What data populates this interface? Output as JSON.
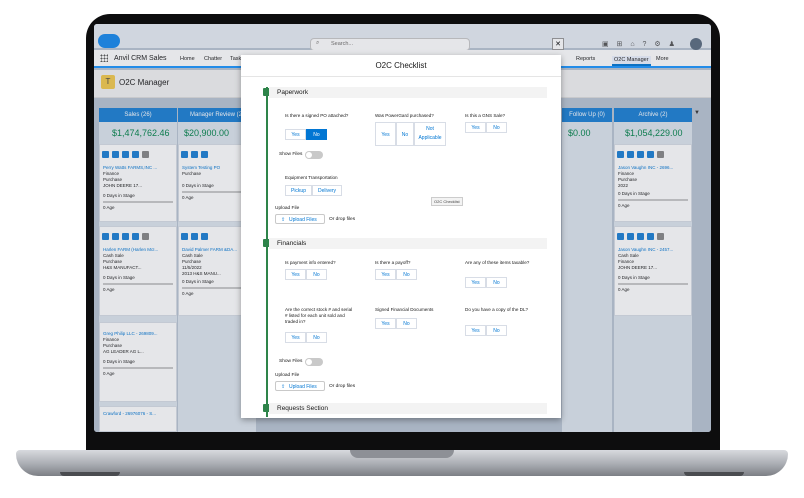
{
  "app": {
    "name": "Anvil CRM Sales",
    "search_placeholder": "Search...",
    "tabs": [
      "Home",
      "Chatter",
      "Task"
    ],
    "right_tabs": [
      "Reports",
      "O2C Manager",
      "More"
    ],
    "page_title": "O2C Manager"
  },
  "board": {
    "sales": {
      "label": "Sales (26)",
      "amount": "$1,474,762.46",
      "cards": [
        {
          "name": "Perry Watts FARMS,INC ...",
          "type": "Finance",
          "sub": "Purchase",
          "product": "JOHN DEERE 17...",
          "stage": "0 Days in Stage",
          "age": "0 Age"
        },
        {
          "name": "Harlen FARM (Harlen McI...",
          "type": "Cash Sale",
          "sub": "Purchase",
          "product": "H&S MANUFACT...",
          "stage": "0 Days in Stage",
          "age": "0 Age"
        },
        {
          "name": "Greg Philip LLC - 269809...",
          "type": "Finance",
          "sub": "Purchase",
          "product": "AG LEADER AG L...",
          "stage": "0 Days in Stage",
          "age": "0 Age"
        },
        {
          "name": "Crawford - 26976076 - S...",
          "type": "",
          "sub": "",
          "product": "",
          "stage": "",
          "age": ""
        }
      ]
    },
    "manager": {
      "label": "Manager Review (2)",
      "amount": "$20,900.00",
      "cards": [
        {
          "name": "System Testing PO",
          "type": "Purchase",
          "sub": "",
          "product": "",
          "stage": "0 Days in Stage",
          "age": "0 Age",
          "extra": "Forge Ahead N..."
        },
        {
          "name": "David Palmer FARM &DA...",
          "type": "Cash Sale",
          "sub": "Purchase",
          "product": "2013 H&S MANU...",
          "date": "11/5/2022",
          "stage": "0 Days in Stage",
          "age": "0 Age"
        }
      ]
    },
    "followup": {
      "label": "Follow Up (0)",
      "amount": "$0.00"
    },
    "archive": {
      "label": "Archive (2)",
      "amount": "$1,054,229.00",
      "cards": [
        {
          "name": "Jason Vaughn INC - 2696...",
          "type": "Finance",
          "sub": "Purchase",
          "product": "JOHN DEE...",
          "date": "2022",
          "stage": "0 Days in Stage",
          "age": "0 Age"
        },
        {
          "name": "Jason Vaughn INC - 2457...",
          "type": "Cash Sale",
          "sub": "Finance",
          "product": "JOHN DEERE 17...",
          "stage": "0 Days in Stage",
          "age": "0 Age"
        }
      ]
    }
  },
  "modal": {
    "title": "O2C Checklist",
    "paperwork": {
      "label": "Paperwork",
      "q1": "Is there a signed PO attached?",
      "q2": "Was PowerGard purchased?",
      "q3": "Is this a GNS Sale?",
      "yes": "Yes",
      "no": "No",
      "na": "Not Applicable",
      "show_files": "Show Files",
      "equip": "Equipment Transportation",
      "pickup": "Pickup",
      "delivery": "Delivery",
      "upload_label": "Upload File",
      "upload_btn": "Upload Files",
      "drop": "Or drop files",
      "tooltip": "O2C Checklist"
    },
    "financials": {
      "label": "Financials",
      "q1": "Is payment info entered?",
      "q2": "Is there a payoff?",
      "q3": "Are any of these items taxable?",
      "q4": "Are the correct stock # and serial # listed for each unit sold and traded in?",
      "q5": "Signed Financial Documents",
      "q6": "Do you have a copy of the DL?"
    },
    "requests": {
      "label": "Requests Section"
    }
  }
}
